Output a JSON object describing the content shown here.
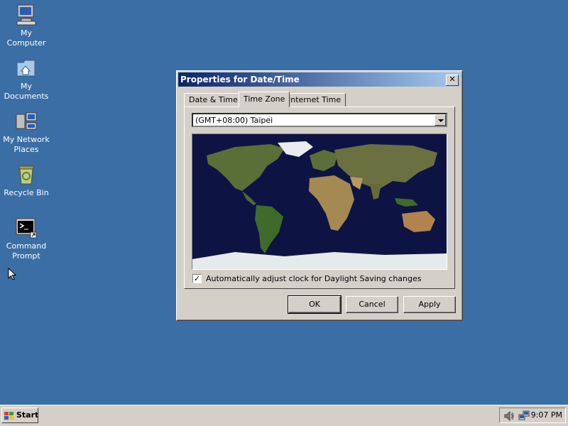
{
  "desktop": {
    "icons": [
      {
        "label": "My\nComputer"
      },
      {
        "label": "My\nDocuments"
      },
      {
        "label": "My Network\nPlaces"
      },
      {
        "label": "Recycle Bin"
      },
      {
        "label": "Command\nPrompt"
      }
    ]
  },
  "dialog": {
    "title": "Properties for Date/Time",
    "close_glyph": "✕",
    "tabs": [
      "Date & Time",
      "Time Zone",
      "Internet Time"
    ],
    "active_tab": "Time Zone",
    "timezone_selected": "(GMT+08:00) Taipei",
    "dst_checkbox_label": "Automatically adjust clock for Daylight Saving changes",
    "dst_checked_glyph": "✓",
    "ok_label": "OK",
    "cancel_label": "Cancel",
    "apply_label": "Apply"
  },
  "taskbar": {
    "start_label": "Start",
    "clock": "9:07 PM"
  },
  "colors": {
    "desktop_bg": "#3a6ea5",
    "titlebar_start": "#0a246a",
    "titlebar_end": "#a6caf0",
    "face": "#d4d0c8"
  }
}
